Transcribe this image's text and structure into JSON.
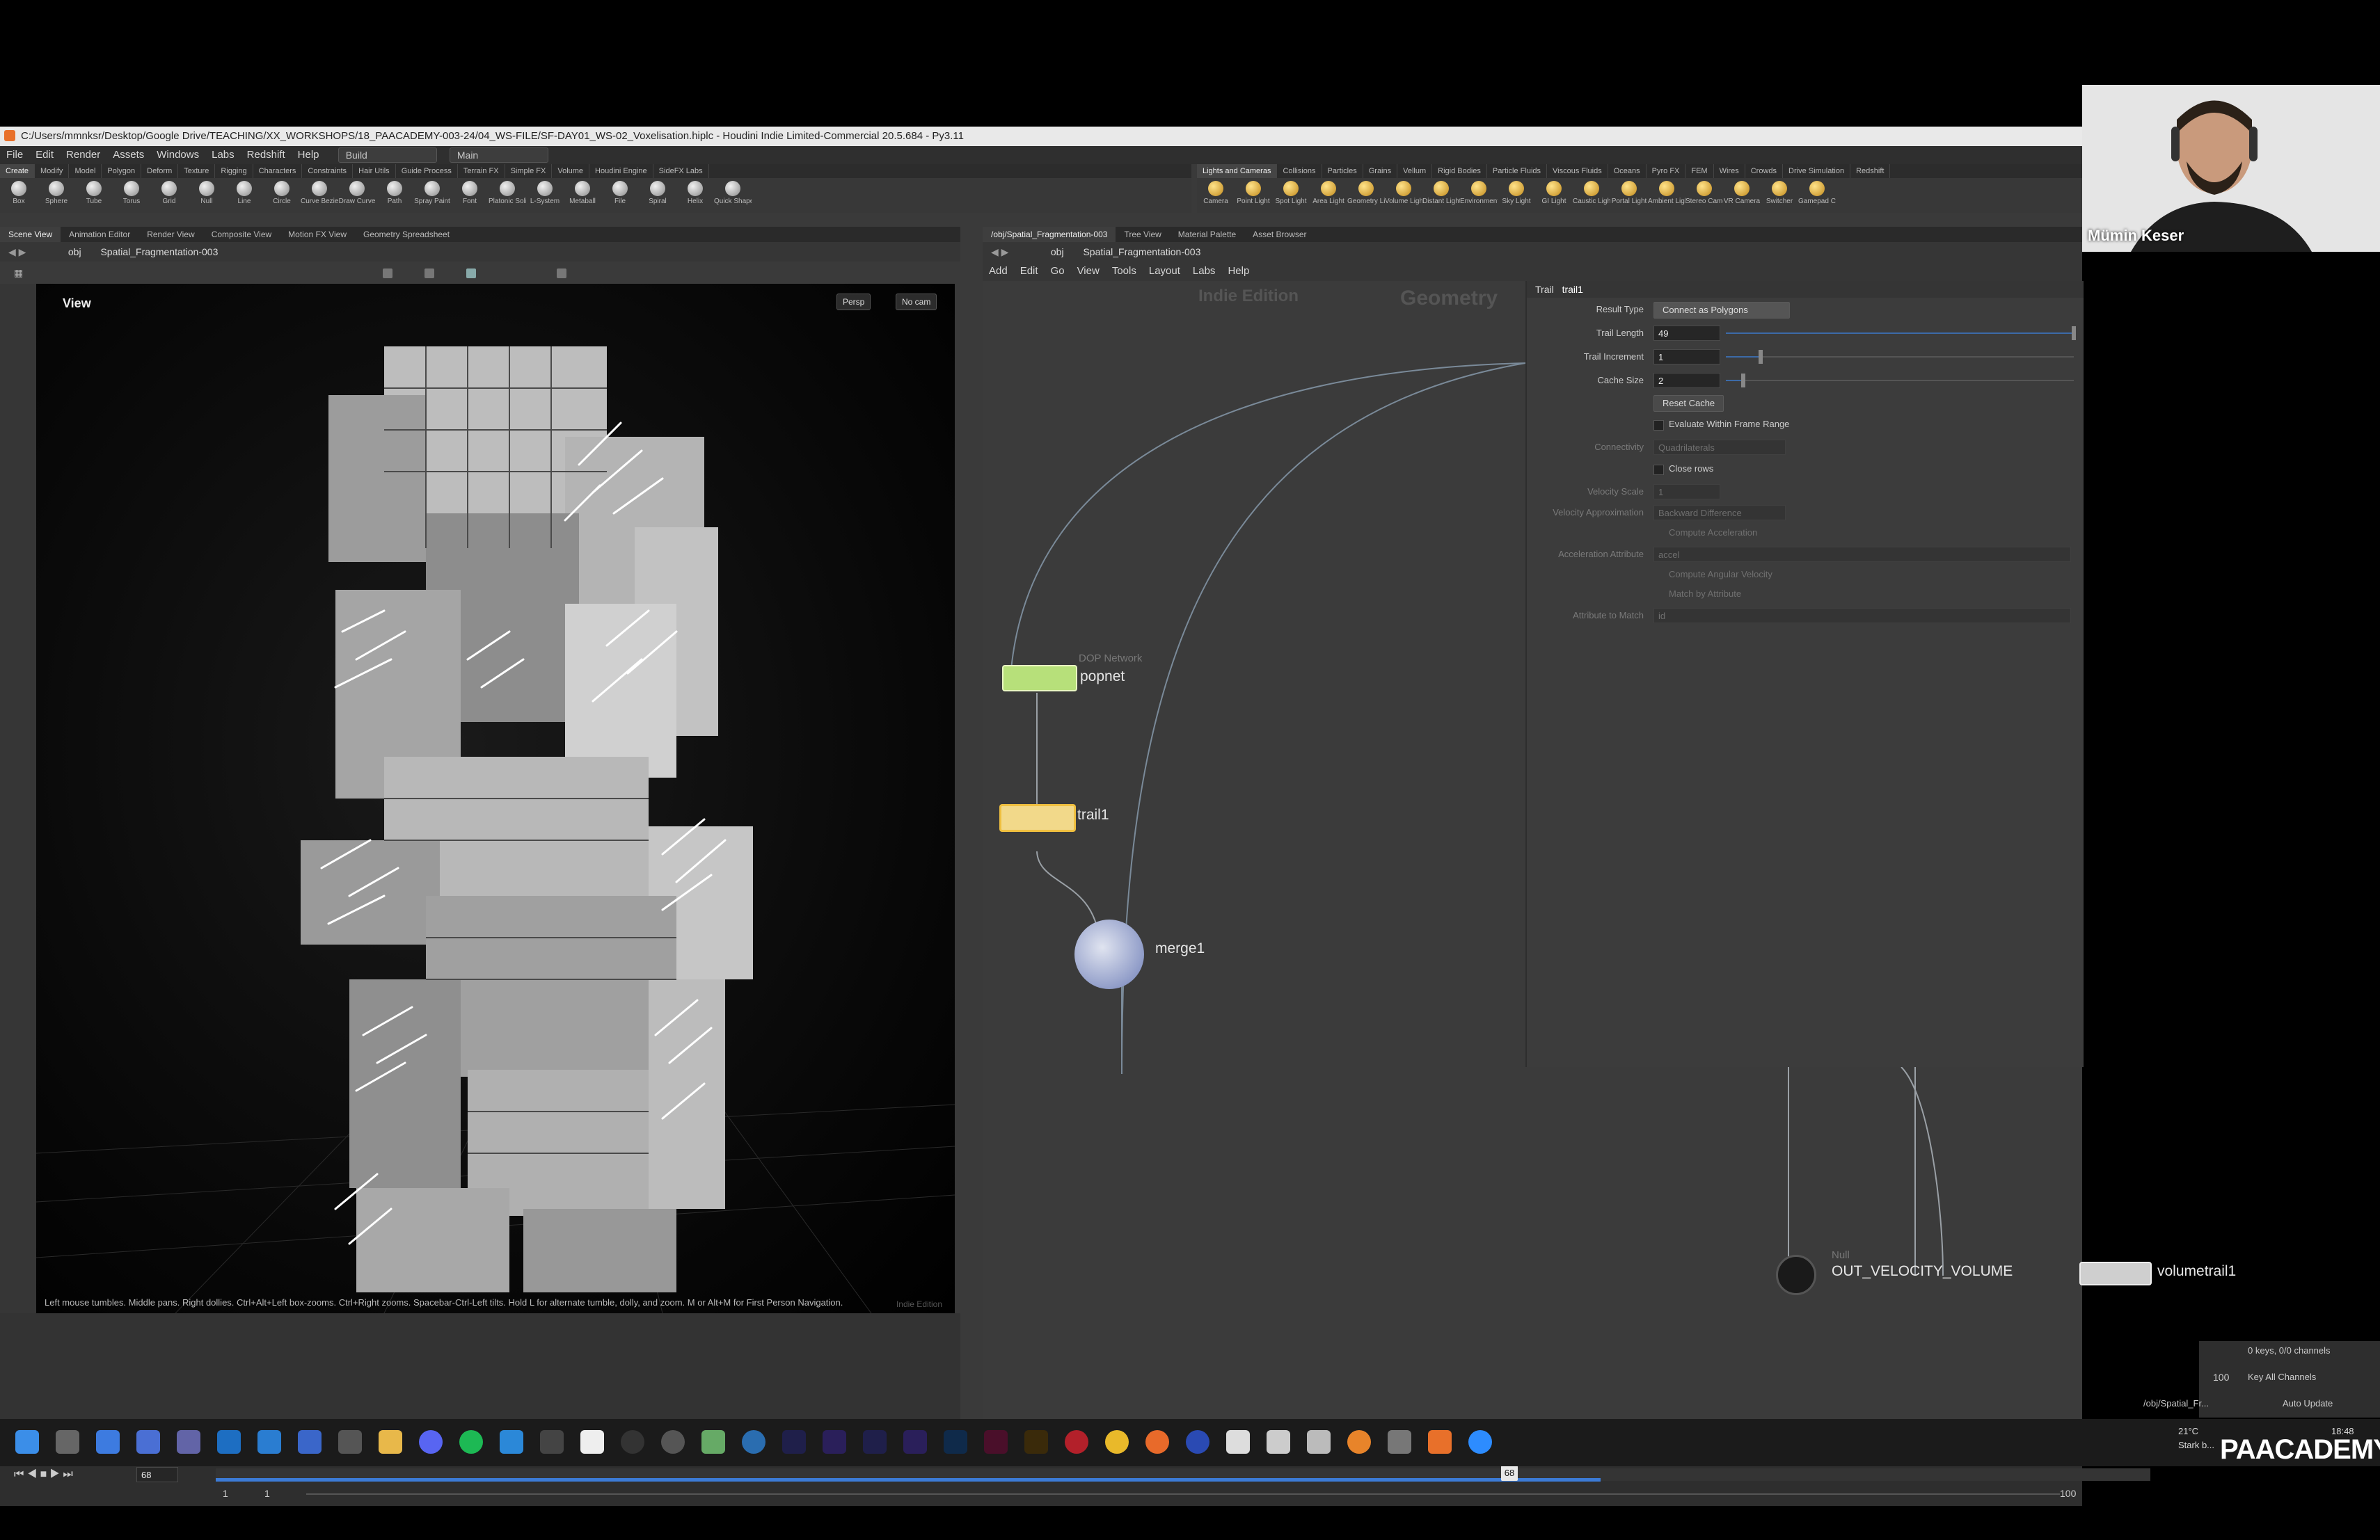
{
  "window": {
    "title": "C:/Users/mmnksr/Desktop/Google Drive/TEACHING/XX_WORKSHOPS/18_PAACADEMY-003-24/04_WS-FILE/SF-DAY01_WS-02_Voxelisation.hiplc - Houdini Indie Limited-Commercial 20.5.684 - Py3.11"
  },
  "menubar": {
    "items": [
      "File",
      "Edit",
      "Render",
      "Assets",
      "Windows",
      "Labs",
      "Redshift",
      "Help"
    ],
    "desktop_label": "Build",
    "layout_label": "Main"
  },
  "shelf": {
    "left_tabs": [
      "Create",
      "Modify",
      "Model",
      "Polygon",
      "Deform",
      "Texture",
      "Rigging",
      "Characters",
      "Constraints",
      "Hair Utils",
      "Guide Process",
      "Terrain FX",
      "Simple FX",
      "Volume",
      "Houdini Engine",
      "SideFX Labs"
    ],
    "left_tools": [
      "Box",
      "Sphere",
      "Tube",
      "Torus",
      "Grid",
      "Null",
      "Line",
      "Circle",
      "Curve Bezier",
      "Draw Curve",
      "Path",
      "Spray Paint",
      "Font",
      "Platonic Solids",
      "L-System",
      "Metaball",
      "File",
      "Spiral",
      "Helix",
      "Quick Shapes"
    ],
    "right_tabs": [
      "Lights and Cameras",
      "Collisions",
      "Particles",
      "Grains",
      "Vellum",
      "Rigid Bodies",
      "Particle Fluids",
      "Viscous Fluids",
      "Oceans",
      "Pyro FX",
      "FEM",
      "Wires",
      "Crowds",
      "Drive Simulation",
      "Redshift"
    ],
    "right_tools": [
      "Camera",
      "Point Light",
      "Spot Light",
      "Area Light",
      "Geometry Light",
      "Volume Light",
      "Distant Light",
      "Environment Light",
      "Sky Light",
      "GI Light",
      "Caustic Light",
      "Portal Light",
      "Ambient Light",
      "Stereo Camera",
      "VR Camera",
      "Switcher",
      "Gamepad Camera"
    ]
  },
  "left_pane": {
    "tabs": [
      "Scene View",
      "Animation Editor",
      "Render View",
      "Composite View",
      "Motion FX View",
      "Geometry Spreadsheet"
    ],
    "path": [
      "obj",
      "Spatial_Fragmentation-003"
    ],
    "viewport_label": "View",
    "camera_persp": "Persp",
    "camera_cam": "No cam",
    "status": "Left mouse tumbles. Middle pans. Right dollies. Ctrl+Alt+Left box-zooms. Ctrl+Right zooms. Spacebar-Ctrl-Left tilts. Hold L for alternate tumble, dolly, and zoom. M or Alt+M for First Person Navigation.",
    "edition_mark": "Indie Edition"
  },
  "right_pane": {
    "tabs": [
      "/obj/Spatial_Fragmentation-003",
      "Tree View",
      "Material Palette",
      "Asset Browser"
    ],
    "path": [
      "obj",
      "Spatial_Fragmentation-003"
    ],
    "menu": [
      "Add",
      "Edit",
      "Go",
      "View",
      "Tools",
      "Layout",
      "Labs",
      "Help"
    ],
    "watermark_edition": "Indie Edition",
    "watermark_context": "Geometry"
  },
  "nodes": {
    "popnet": {
      "label": "popnet",
      "sub": "DOP Network"
    },
    "trail1": {
      "label": "trail1"
    },
    "merge1": {
      "label": "merge1"
    },
    "out": {
      "label": "OUT_VELOCITY_VOLUME",
      "sub": "Null"
    },
    "volumetrail1": {
      "label": "volumetrail1"
    }
  },
  "params": {
    "node_type": "Trail",
    "node_name": "trail1",
    "result_type_label": "Result Type",
    "result_type_value": "Connect as Polygons",
    "trail_length_label": "Trail Length",
    "trail_length_value": "49",
    "trail_length_fraction": 1.0,
    "trail_increment_label": "Trail Increment",
    "trail_increment_value": "1",
    "trail_increment_fraction": 0.1,
    "cache_size_label": "Cache Size",
    "cache_size_value": "2",
    "cache_size_fraction": 0.05,
    "reset_cache": "Reset Cache",
    "evaluate_range": "Evaluate Within Frame Range",
    "connectivity_label": "Connectivity",
    "connectivity_value": "Quadrilaterals",
    "close_rows": "Close rows",
    "velocity_scale_label": "Velocity Scale",
    "velocity_scale_value": "1",
    "velocity_approx_label": "Velocity Approximation",
    "velocity_approx_value": "Backward Difference",
    "compute_accel": "Compute Acceleration",
    "accel_attr_label": "Acceleration Attribute",
    "accel_attr_value": "accel",
    "compute_angular": "Compute Angular Velocity",
    "match_attr": "Match by Attribute",
    "attr_to_match_label": "Attribute to Match",
    "attr_to_match_value": "id"
  },
  "timeline": {
    "current_frame": "68",
    "start": "1",
    "start2": "1",
    "end": "100",
    "end2": "100",
    "keys_info": "0 keys, 0/0 channels",
    "key_all": "Key All Channels",
    "auto_update": "Auto Update",
    "path_short": "/obj/Spatial_Fr..."
  },
  "webcam": {
    "name": "Mümin Keser"
  },
  "taskbar": {
    "temp": "21°C",
    "weather": "Stark b...",
    "time": "18:48"
  },
  "brand": "PAACADEMY"
}
